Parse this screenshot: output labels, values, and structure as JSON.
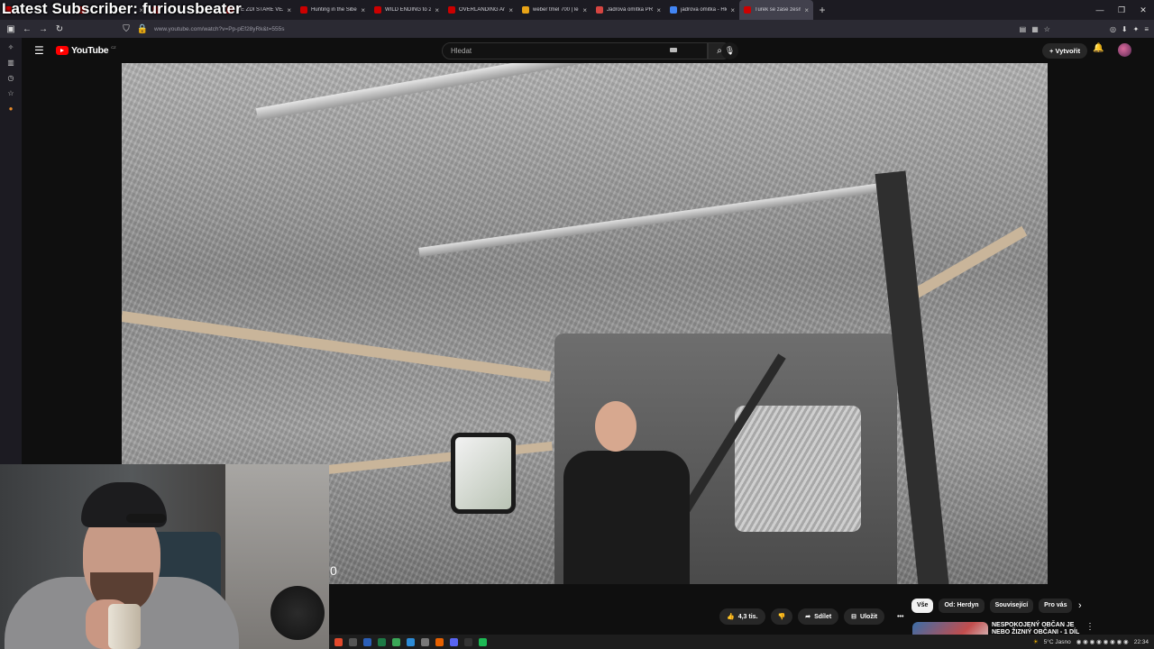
{
  "overlay": {
    "stream_title": "Latest Subscriber: furiousbeater"
  },
  "browser": {
    "tabs": [
      {
        "title": "",
        "color": "#cc0000"
      },
      {
        "title": "",
        "color": "#cc0000"
      },
      {
        "title": "",
        "color": "#cc0000"
      },
      {
        "title": "VE ZDI STARÉ VĚZNICE BYLA D",
        "color": "#cc0000"
      },
      {
        "title": "Hunting in the Siberian Taiga: Y",
        "color": "#cc0000"
      },
      {
        "title": "WILD ENDING to 20,000km Fro",
        "color": "#cc0000"
      },
      {
        "title": "OVERLANDING And EXPLORIN",
        "color": "#cc0000"
      },
      {
        "title": "weber tmel 700 | lepicí a stěrko",
        "color": "#e8a317"
      },
      {
        "title": "Jádrová omítka PRECIT univerzá",
        "color": "#d64541"
      },
      {
        "title": "jadrova omitka - Hledat Google",
        "color": "#4285f4"
      },
      {
        "title": "Turek se zase zesměšnil - Y",
        "color": "#cc0000"
      }
    ],
    "new_tab": "+",
    "url": "www.youtube.com/watch?v=Pp-pEf28yRk&t=555s"
  },
  "youtube": {
    "logo_text": "YouTube",
    "logo_region": "CZ",
    "search_placeholder": "Hledat",
    "create_label": "Vytvořit",
    "video": {
      "overlay_digit": "0"
    },
    "actions": {
      "like_count": "4,3 tis.",
      "share_label": "Sdílet",
      "save_label": "Uložit"
    },
    "chips": [
      "Vše",
      "Od: Herdyn",
      "Související",
      "Pro vás"
    ],
    "recommendation": {
      "title": "NESPOKOJENÝ OBČAN JE NEBO ŽIZNIÝ OBČANI - 1 DÍL"
    }
  },
  "taskbar": {
    "weather": "5°C  Jasno",
    "time": "22:34"
  }
}
